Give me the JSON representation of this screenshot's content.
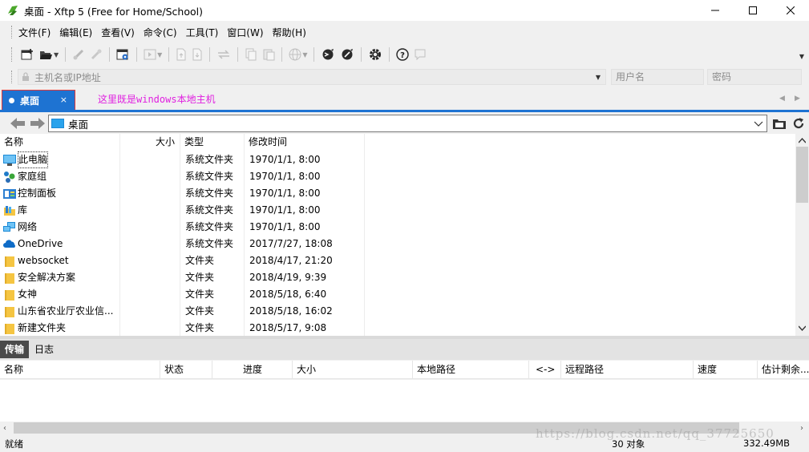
{
  "window": {
    "title": "桌面 - Xftp 5 (Free for Home/School)",
    "controls": {
      "minimize": "minimize-icon",
      "maximize": "maximize-icon",
      "close": "close-icon"
    }
  },
  "menubar": {
    "items": [
      "文件(F)",
      "编辑(E)",
      "查看(V)",
      "命令(C)",
      "工具(T)",
      "窗口(W)",
      "帮助(H)"
    ]
  },
  "hostbar": {
    "host_placeholder": "主机名或IP地址",
    "username_placeholder": "用户名",
    "password_placeholder": "密码"
  },
  "tabs": {
    "active_label": "桌面",
    "close_glyph": "×",
    "annotation": "这里既是windows本地主机"
  },
  "pathbar": {
    "path": "桌面"
  },
  "filelist": {
    "columns": {
      "name": "名称",
      "size": "大小",
      "type": "类型",
      "modified": "修改时间"
    },
    "rows": [
      {
        "name": "此电脑",
        "size": "",
        "type": "系统文件夹",
        "modified": "1970/1/1, 8:00",
        "icon": "computer-icon"
      },
      {
        "name": "家庭组",
        "size": "",
        "type": "系统文件夹",
        "modified": "1970/1/1, 8:00",
        "icon": "homegroup-icon"
      },
      {
        "name": "控制面板",
        "size": "",
        "type": "系统文件夹",
        "modified": "1970/1/1, 8:00",
        "icon": "control-panel-icon"
      },
      {
        "name": "库",
        "size": "",
        "type": "系统文件夹",
        "modified": "1970/1/1, 8:00",
        "icon": "library-icon"
      },
      {
        "name": "网络",
        "size": "",
        "type": "系统文件夹",
        "modified": "1970/1/1, 8:00",
        "icon": "network-icon"
      },
      {
        "name": "OneDrive",
        "size": "",
        "type": "系统文件夹",
        "modified": "2017/7/27, 18:08",
        "icon": "onedrive-icon"
      },
      {
        "name": "websocket",
        "size": "",
        "type": "文件夹",
        "modified": "2018/4/17, 21:20",
        "icon": "folder-icon"
      },
      {
        "name": "安全解决方案",
        "size": "",
        "type": "文件夹",
        "modified": "2018/4/19, 9:39",
        "icon": "folder-icon"
      },
      {
        "name": " 女神",
        "size": "",
        "type": "文件夹",
        "modified": "2018/5/18, 6:40",
        "icon": "folder-icon"
      },
      {
        "name": "山东省农业厅农业信...",
        "size": "",
        "type": "文件夹",
        "modified": "2018/5/18, 16:02",
        "icon": "folder-icon"
      },
      {
        "name": "新建文件夹",
        "size": "",
        "type": "文件夹",
        "modified": "2018/5/17, 9:08",
        "icon": "folder-icon"
      }
    ]
  },
  "transfer": {
    "tabs": [
      "传输",
      "日志"
    ],
    "columns": [
      "名称",
      "状态",
      "进度",
      "大小",
      "本地路径",
      "<->",
      "远程路径",
      "速度",
      "估计剩余..."
    ]
  },
  "statusbar": {
    "left": "就绪",
    "count": "30 对象",
    "size": "332.49MB"
  },
  "watermark": "https://blog.csdn.net/qq_37725650",
  "colors": {
    "accent": "#1e73d2",
    "annotation": "#e020e0",
    "folder": "#f5c542"
  }
}
